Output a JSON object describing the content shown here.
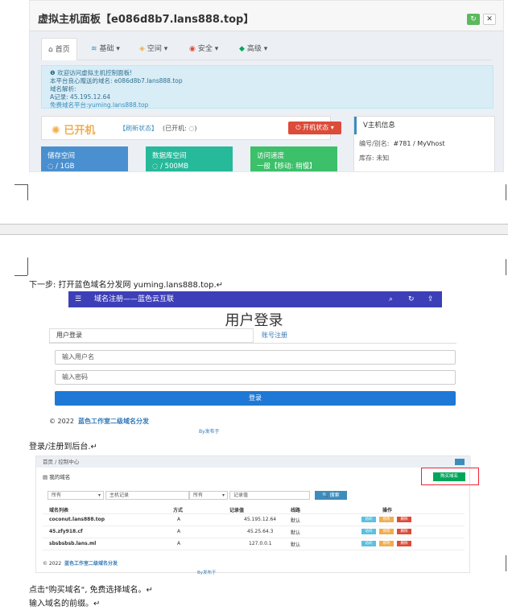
{
  "vhost": {
    "title": "虚拟主机面板【e086d8b7.lans888.top】",
    "tabs": [
      {
        "icon": "home-icon",
        "label": "首页"
      },
      {
        "icon": "layers-icon",
        "label": "基础 ▾"
      },
      {
        "icon": "cube-icon",
        "label": "空间 ▾"
      },
      {
        "icon": "shield-icon",
        "label": "安全 ▾"
      },
      {
        "icon": "diamond-icon",
        "label": "高级 ▾"
      }
    ],
    "notice": [
      "❶ 欢迎访问虚拟主机控制面板!",
      "本平台良心赠送的域名: e086d8b7.lans888.top",
      "域名解析:",
      "A记录: 45.195.12.64",
      "免费域名平台:yuming.lans888.top"
    ],
    "status": "已开机",
    "status_link": "【刷新状态】",
    "status_note": "(已开机: ◌)",
    "power_button": "⏻ 开机状态 ▾",
    "cards": [
      {
        "title": "储存空间",
        "value": "◌ / 1GB",
        "color": "#4a90d0"
      },
      {
        "title": "数据库空间",
        "value": "◌ / 500MB",
        "color": "#26b99a"
      },
      {
        "title": "访问速度",
        "value": "一般【移动: 稍慢】",
        "color": "#3cc06a"
      }
    ],
    "info": {
      "header": "V主机信息",
      "rows": [
        {
          "k": "编号/别名:",
          "v": "#781 / MyVhost"
        },
        {
          "k": "库存:",
          "v": "未知"
        }
      ]
    }
  },
  "doc": {
    "step1": "下一步: 打开蓝色域名分发网 yuming.lans888.top.↵",
    "step2": "登录/注册到后台.↵",
    "step3a": "点击\"购买域名\", 免费选择域名。↵",
    "step3b": "输入域名的前缀。↵"
  },
  "login": {
    "nav_title": "域名注册——蓝色云互联",
    "heading": "用户登录",
    "tab_login": "用户登录",
    "tab_register": "账号注册",
    "user_placeholder": "输入用户名",
    "pass_placeholder": "输入密码",
    "button": "登录",
    "copyright": "© 2022",
    "copyright_link": "蓝色工作室二级域名分发",
    "footer": "By发布于"
  },
  "domains": {
    "breadcrumb": "首页 / 控制中心",
    "heading": "▤ 我的域名",
    "buy_button": "购买域名",
    "filters": [
      "所有",
      "主机记录",
      "所有",
      "记录值"
    ],
    "search": "🔍 搜索",
    "columns": [
      "域名列表",
      "方式",
      "记录值",
      "线路",
      "操作"
    ],
    "rows": [
      {
        "domain": "coconut.lans888.top",
        "type": "A",
        "value": "45.195.12.64",
        "line": "默认"
      },
      {
        "domain": "45.zfy918.cf",
        "type": "A",
        "value": "45.25.64.3",
        "line": "默认"
      },
      {
        "domain": "sbsbsbsb.lans.ml",
        "type": "A",
        "value": "127.0.0.1",
        "line": "默认"
      }
    ],
    "ops": [
      "访问",
      "修改",
      "删除"
    ],
    "copyright": "© 2022",
    "copyright_link": "蓝色工作室二级域名分发",
    "footer": "By发布于"
  }
}
